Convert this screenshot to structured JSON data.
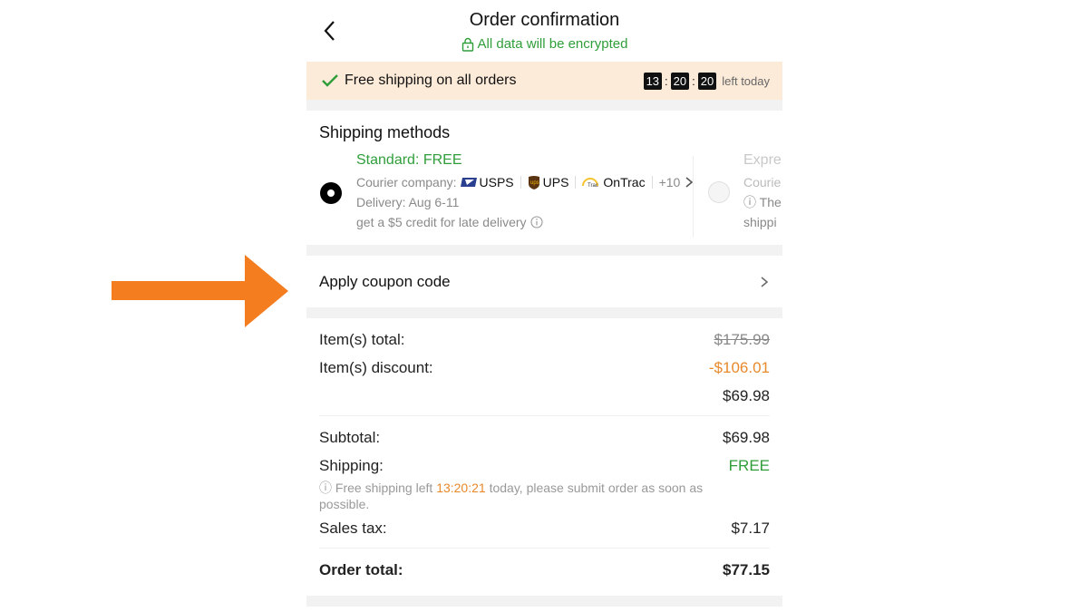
{
  "colors": {
    "accent_green": "#2f9e3a",
    "discount_orange": "#e8892b",
    "banner_bg": "#fdebd9",
    "arrow": "#f47d20"
  },
  "annotation": {
    "icon": "arrow-right-icon"
  },
  "header": {
    "back_icon": "chevron-left-icon",
    "title": "Order confirmation",
    "lock_icon": "lock-icon",
    "subtitle": "All data will be encrypted"
  },
  "banner": {
    "check_icon": "check-icon",
    "text": "Free shipping on all orders",
    "countdown": {
      "hours": "13",
      "minutes": "20",
      "seconds": "20"
    },
    "suffix": "left today"
  },
  "shipping": {
    "title": "Shipping methods",
    "options": [
      {
        "selected": true,
        "title": "Standard: FREE",
        "courier_label": "Courier company:",
        "couriers": [
          "USPS",
          "UPS",
          "OnTrac"
        ],
        "more": "+10",
        "delivery": "Delivery: Aug 6-11",
        "credit": "get a $5 credit for late delivery"
      },
      {
        "selected": false,
        "title": "Expre",
        "line1": "Courie",
        "line2": "The",
        "line3": "shippi"
      }
    ]
  },
  "coupon": {
    "label": "Apply coupon code",
    "chevron_icon": "chevron-right-icon"
  },
  "summary": {
    "items_total_label": "Item(s) total:",
    "items_total_value": "$175.99",
    "items_discount_label": "Item(s) discount:",
    "items_discount_value": "-$106.01",
    "items_net_value": "$69.98",
    "subtotal_label": "Subtotal:",
    "subtotal_value": "$69.98",
    "shipping_label": "Shipping:",
    "shipping_value": "FREE",
    "shipping_note_prefix": "Free shipping left ",
    "shipping_note_time": "13:20:21",
    "shipping_note_suffix": " today, please submit order as soon as possible.",
    "sales_tax_label": "Sales tax:",
    "sales_tax_value": "$7.17",
    "order_total_label": "Order total:",
    "order_total_value": "$77.15"
  }
}
